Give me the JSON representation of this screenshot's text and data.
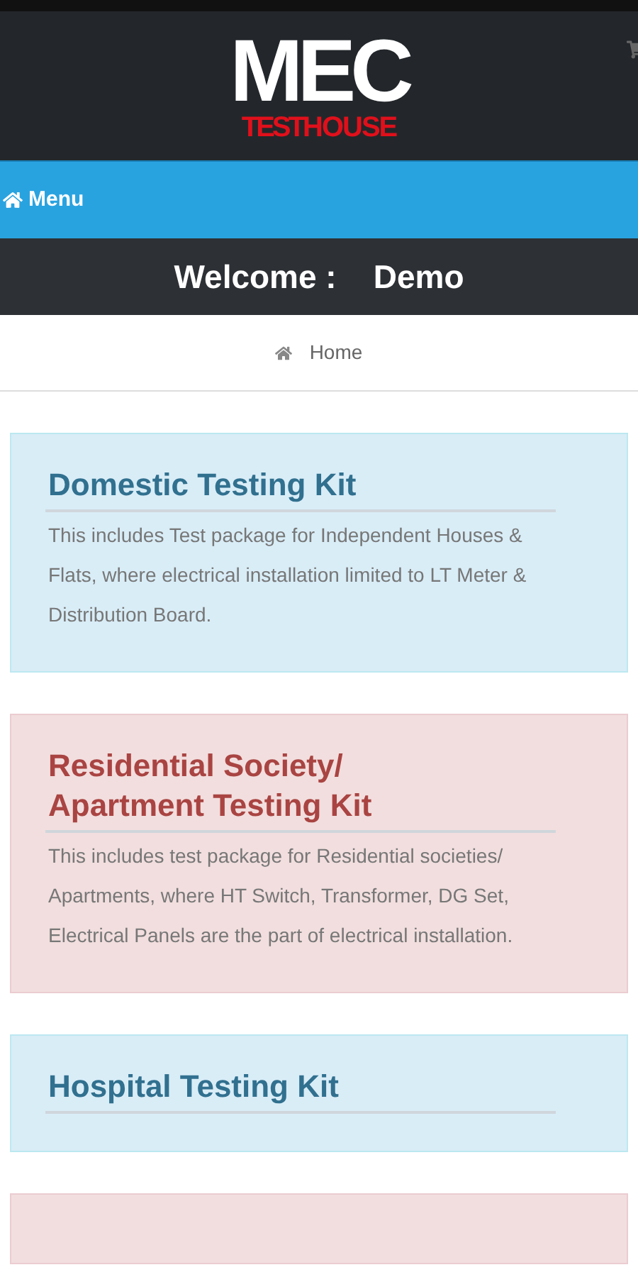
{
  "logo": {
    "main": "MEC",
    "sub_bold": "TEST",
    "sub": "HOUSE"
  },
  "nav": {
    "menu_label": "Menu"
  },
  "welcome": {
    "label": "Welcome :",
    "user": "Demo"
  },
  "breadcrumb": {
    "items": [
      "Home"
    ]
  },
  "cards": [
    {
      "kind": "info",
      "title": "Domestic Testing Kit",
      "text": "This includes Test package for Independent Houses & Flats, where electrical installation limited to LT Meter & Distribution Board."
    },
    {
      "kind": "danger",
      "title": "Residential Society/ Apartment Testing Kit",
      "text": "This includes test package for Residential societies/ Apartments, where HT Switch, Transformer, DG Set, Electrical Panels are the part of electrical installation."
    },
    {
      "kind": "info",
      "title": "Hospital Testing Kit"
    },
    {
      "kind": "danger"
    }
  ]
}
